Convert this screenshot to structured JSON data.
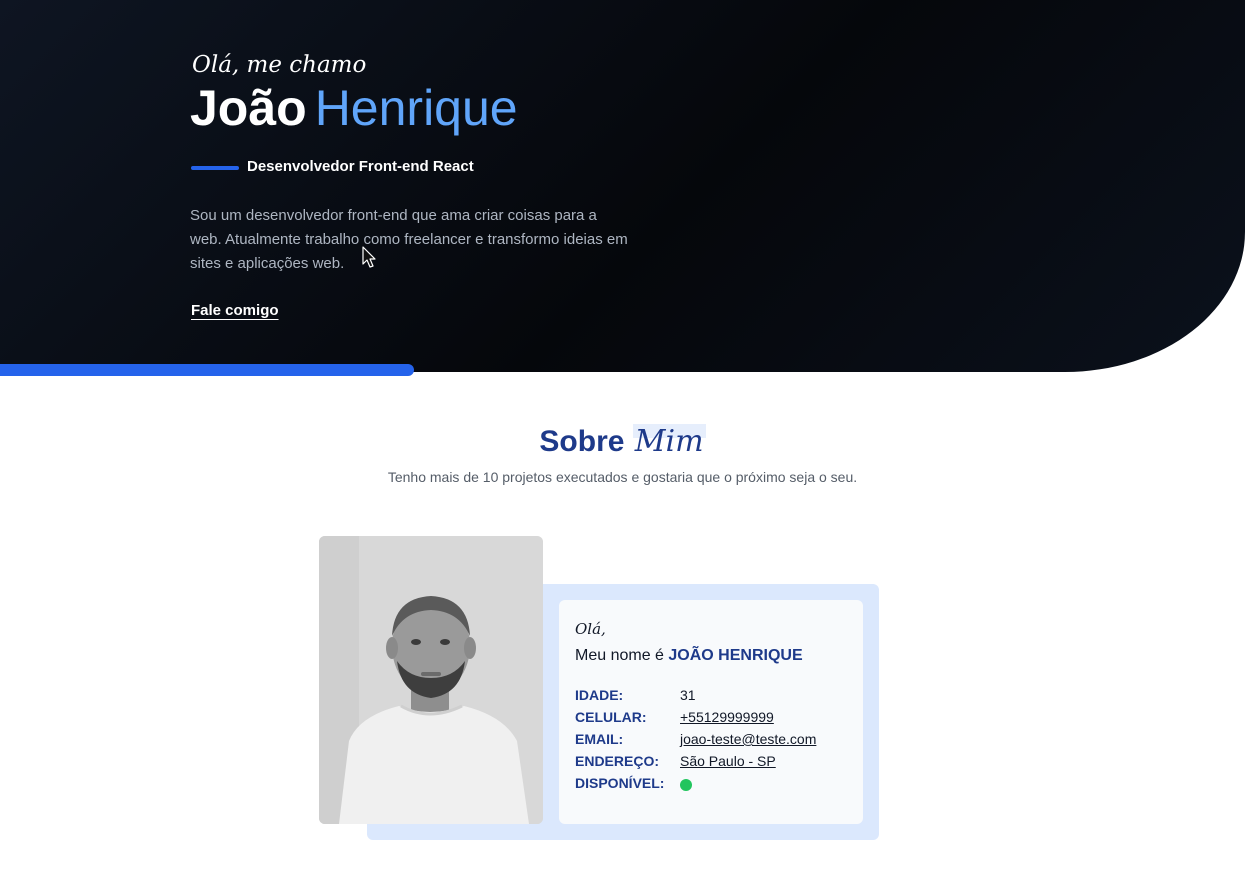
{
  "hero": {
    "greeting": "Olá, me chamo",
    "first_name": "João",
    "last_name": "Henrique",
    "role": "Desenvolvedor Front-end React",
    "description": "Sou um desenvolvedor front-end que ama criar coisas para a web. Atualmente trabalho como freelancer e transformo ideias em sites e aplicações web.",
    "cta_label": "Fale comigo"
  },
  "about": {
    "title_main": "Sobre",
    "title_accent": "Mim",
    "subtitle": "Tenho mais de 10 projetos executados e gostaria que o próximo seja o seu.",
    "card": {
      "hello": "Olá,",
      "name_prefix": "Meu nome é",
      "name": "JOÃO HENRIQUE",
      "rows": [
        {
          "label": "IDADE:",
          "value": "31"
        },
        {
          "label": "CELULAR:",
          "value": "+55129999999"
        },
        {
          "label": "EMAIL:",
          "value": "joao-teste@teste.com"
        },
        {
          "label": "ENDEREÇO:",
          "value": "São Paulo - SP"
        },
        {
          "label": "DISPONÍVEL:",
          "value": ""
        }
      ]
    }
  },
  "colors": {
    "accent_blue": "#2563eb",
    "light_blue": "#60a5fa",
    "navy": "#1e3a8a",
    "available_green": "#22c55e"
  },
  "icons": {
    "cursor": "mouse-pointer-icon",
    "status": "available-status-dot-icon"
  }
}
